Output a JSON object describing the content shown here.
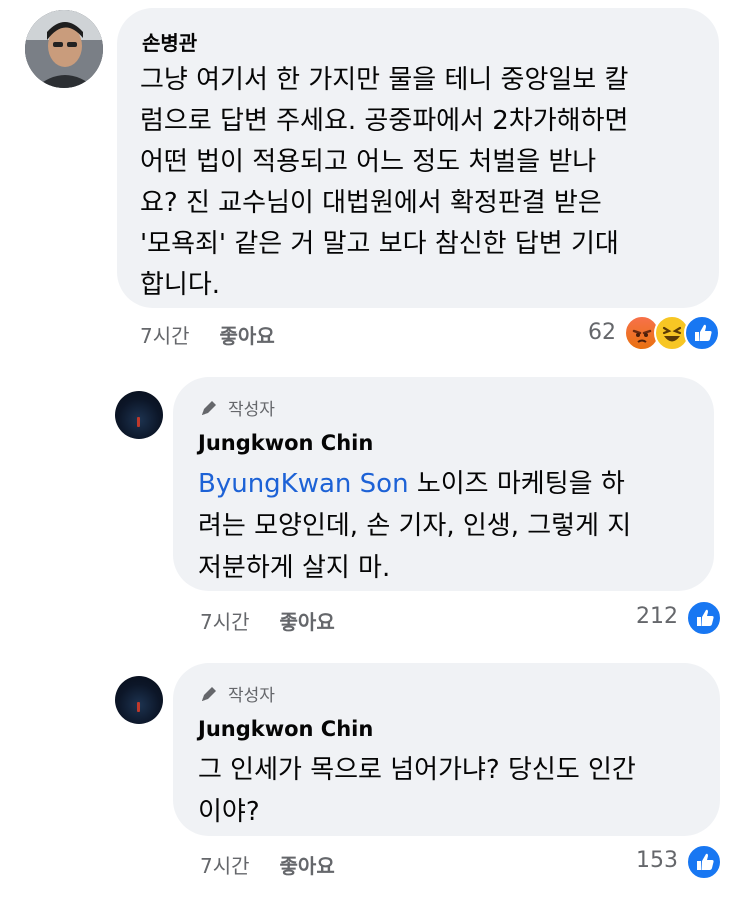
{
  "comment": {
    "author": "손병관",
    "lines": [
      "그냥 여기서 한 가지만 물을 테니 중앙일보 칼",
      "럼으로 답변 주세요. 공중파에서 2차가해하면",
      "어떤 법이 적용되고 어느 정도 처벌을 받나",
      "요? 진 교수님이 대법원에서 확정판결 받은",
      "'모욕죄' 같은 거 말고 보다 참신한 답변 기대",
      "합니다."
    ],
    "time": "7시간",
    "like_label": "좋아요",
    "reaction_count": "62",
    "reaction_icons": [
      "angry-icon",
      "haha-icon",
      "like-icon"
    ]
  },
  "replies": [
    {
      "author_tag": "작성자",
      "author": "Jungkwon Chin",
      "mention": "ByungKwan Son",
      "text_line1": "노이즈 마케팅을 하",
      "text_lines_rest": [
        "려는 모양인데, 손 기자, 인생, 그렇게 지",
        "저분하게 살지 마."
      ],
      "time": "7시간",
      "like_label": "좋아요",
      "reaction_count": "212"
    },
    {
      "author_tag": "작성자",
      "author": "Jungkwon Chin",
      "lines": [
        "그 인세가 목으로 넘어가냐? 당신도 인간",
        "이야?"
      ],
      "time": "7시간",
      "like_label": "좋아요",
      "reaction_count": "153"
    }
  ],
  "colors": {
    "bubble": "#f0f2f5",
    "mention": "#1d62d6",
    "meta_text": "#65676b",
    "like_blue": "#1877f2"
  }
}
